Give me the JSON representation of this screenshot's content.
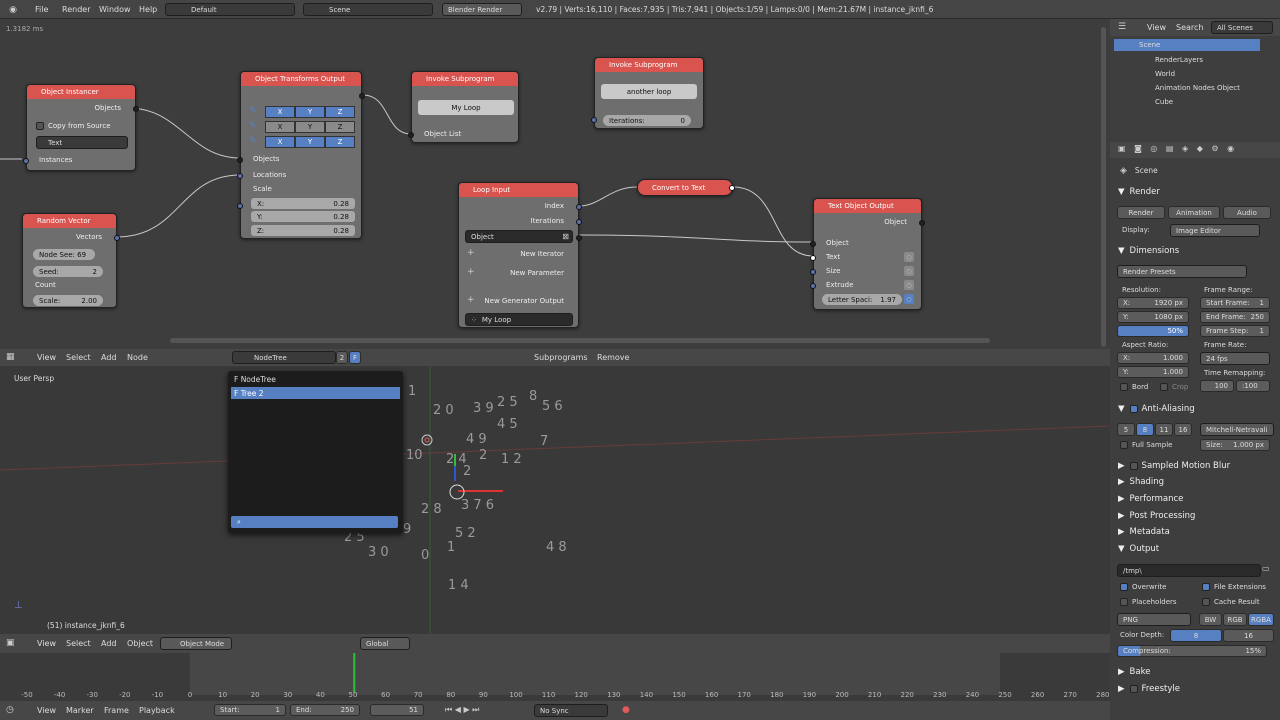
{
  "topbar": {
    "menu": [
      "File",
      "Render",
      "Window",
      "Help"
    ],
    "layout": "Default",
    "scene": "Scene",
    "engine": "Blender Render",
    "stats": "v2.79 | Verts:16,110 | Faces:7,935 | Tris:7,941 | Objects:1/59 | Lamps:0/0 | Mem:21.67M | instance_jknfi_6"
  },
  "node_editor": {
    "timing": "1.3182 ms",
    "nodes": {
      "object_instancer": {
        "title": "Object Instancer",
        "out_objects": "Objects",
        "copy_from_source": "Copy from Source",
        "type": "Text",
        "in_instances": "Instances"
      },
      "random_vector": {
        "title": "Random Vector",
        "out_vectors": "Vectors",
        "node_seed": "Node See: 69",
        "seed_label": "Seed:",
        "seed_value": "2",
        "count": "Count",
        "scale_label": "Scale:",
        "scale_value": "2.00"
      },
      "obj_transforms": {
        "title": "Object Transforms Output",
        "in_objects": "Objects",
        "in_locations": "Locations",
        "in_scale": "Scale",
        "axes": [
          "X",
          "Y",
          "Z"
        ],
        "sx_label": "X:",
        "sx": "0.28",
        "sy_label": "Y:",
        "sy": "0.28",
        "sz_label": "Z:",
        "sz": "0.28"
      },
      "invoke1": {
        "title": "Invoke Subprogram",
        "program": "My Loop",
        "in_list": "Object List"
      },
      "invoke2": {
        "title": "Invoke Subprogram",
        "program": "another loop",
        "iter_label": "Iterations:",
        "iter_value": "0"
      },
      "loop_input": {
        "title": "Loop Input",
        "index": "Index",
        "iterations": "Iterations",
        "object": "Object",
        "new_iterator": "New Iterator",
        "new_parameter": "New Parameter",
        "new_generator": "New Generator Output",
        "loop_name": "My Loop"
      },
      "convert": {
        "title": "Convert to Text"
      },
      "text_output": {
        "title": "Text Object Output",
        "out_object": "Object",
        "in_object": "Object",
        "in_text": "Text",
        "in_size": "Size",
        "in_extrude": "Extrude",
        "spacing_label": "Letter Spaci:",
        "spacing_value": "1.97"
      }
    }
  },
  "node_header": {
    "menu": [
      "View",
      "Select",
      "Add",
      "Node"
    ],
    "tree": "NodeTree",
    "users": "2",
    "fake": "F",
    "subprograms": "Subprograms",
    "remove": "Remove"
  },
  "dropdown": {
    "items": [
      "F NodeTree",
      "F Tree 2"
    ],
    "search_placeholder": ""
  },
  "viewport": {
    "label": "User Persp",
    "object_info": "(51) instance_jknfi_6",
    "numbers": [
      "1",
      "2 0",
      "3 9",
      "2 5",
      "8",
      "5 6",
      "4 5",
      "7",
      "4 9",
      "10",
      "2 4",
      "2",
      "1 2",
      "2",
      "2 8",
      "3 7 6",
      "2 5",
      "5 2",
      "3 0",
      "0",
      "4 8",
      "1",
      "1 4",
      "9"
    ]
  },
  "view3d_header": {
    "menu": [
      "View",
      "Select",
      "Add",
      "Object"
    ],
    "mode": "Object Mode",
    "orientation": "Global"
  },
  "timeline": {
    "ticks": [
      "-50",
      "-40",
      "-30",
      "-20",
      "-10",
      "0",
      "10",
      "20",
      "30",
      "40",
      "50",
      "60",
      "70",
      "80",
      "90",
      "100",
      "110",
      "120",
      "130",
      "140",
      "150",
      "160",
      "170",
      "180",
      "190",
      "200",
      "210",
      "220",
      "230",
      "240",
      "250",
      "260",
      "270",
      "280"
    ],
    "current_frame_value": 51,
    "menu": [
      "View",
      "Marker",
      "Frame",
      "Playback"
    ],
    "start_label": "Start:",
    "start": "1",
    "end_label": "End:",
    "end": "250",
    "current": "51",
    "sync": "No Sync"
  },
  "outliner": {
    "menu": [
      "View",
      "Search",
      "All Scenes"
    ],
    "items": [
      "Scene",
      "RenderLayers",
      "World",
      "Animation Nodes Object",
      "Cube"
    ]
  },
  "properties": {
    "context": "Scene",
    "render_header": "Render",
    "tabs": [
      "Render",
      "Animation",
      "Audio"
    ],
    "display_label": "Display:",
    "display_value": "Image Editor",
    "dimensions": "Dimensions",
    "presets": "Render Presets",
    "resolution": "Resolution:",
    "res_x": "X:",
    "res_x_val": "1920 px",
    "res_y": "Y:",
    "res_y_val": "1080 px",
    "res_pct": "50%",
    "frame_range": "Frame Range:",
    "start_frame": "Start Frame:",
    "start_frame_val": "1",
    "end_frame": "End Frame:",
    "end_frame_val": "250",
    "frame_step": "Frame Step:",
    "frame_step_val": "1",
    "aspect": "Aspect Ratio:",
    "asp_x": "X:",
    "asp_x_val": "1.000",
    "asp_y": "Y:",
    "asp_y_val": "1.000",
    "frame_rate": "Frame Rate:",
    "fps": "24 fps",
    "time_remap": "Time Remapping:",
    "remap_old": "100",
    "remap_new": ":100",
    "bord": "Bord",
    "crop": "Crop",
    "aa": "Anti-Aliasing",
    "aa_samples": [
      "5",
      "8",
      "11",
      "16"
    ],
    "aa_filter": "Mitchell-Netravali",
    "full_sample": "Full Sample",
    "size_label": "Size:",
    "size_val": "1.000 px",
    "sections": [
      "Sampled Motion Blur",
      "Shading",
      "Performance",
      "Post Processing",
      "Metadata"
    ],
    "output": "Output",
    "path": "/tmp\\",
    "overwrite": "Overwrite",
    "file_ext": "File Extensions",
    "placeholders": "Placeholders",
    "cache": "Cache Result",
    "format": "PNG",
    "color_modes": [
      "BW",
      "RGB",
      "RGBA"
    ],
    "color_depth": "Color Depth:",
    "depths": [
      "8",
      "16"
    ],
    "compression": "Compression:",
    "compression_val": "15%",
    "bake": "Bake",
    "freestyle": "Freestyle"
  },
  "colors": {
    "node_header": "#d9534f",
    "accent": "#5680c2",
    "playhead": "#2fbf3a"
  }
}
